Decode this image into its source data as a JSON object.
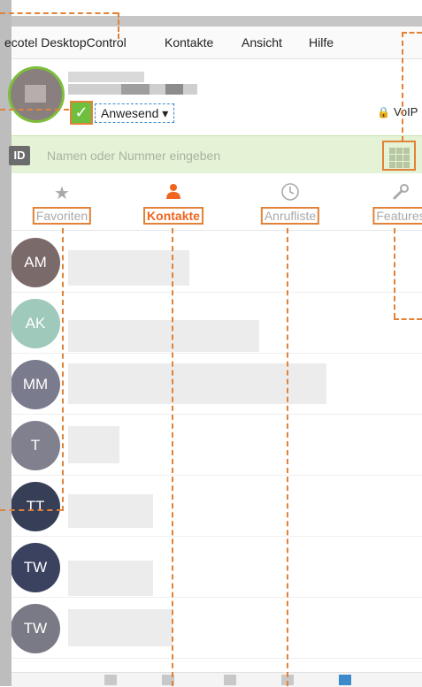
{
  "menu": {
    "app_title": "ecotel DesktopControl",
    "items": [
      "Kontakte",
      "Ansicht",
      "Hilfe"
    ]
  },
  "profile": {
    "status_label": "Anwesend",
    "status_caret": "▾",
    "voip_label": "VoIP",
    "status_color": "#6fbf3f"
  },
  "search": {
    "id_label": "ID",
    "placeholder": "Namen oder Nummer eingeben"
  },
  "tabs": [
    {
      "label": "Favoriten",
      "icon": "star-icon",
      "active": false
    },
    {
      "label": "Kontakte",
      "icon": "person-icon",
      "active": true
    },
    {
      "label": "Anrufliste",
      "icon": "clock-icon",
      "active": false
    },
    {
      "label": "Features",
      "icon": "wrench-icon",
      "active": false
    }
  ],
  "contacts": [
    {
      "initials": "AM",
      "color": "#7b6a6a"
    },
    {
      "initials": "AK",
      "color": "#9fc9bb"
    },
    {
      "initials": "MM",
      "color": "#7b7b8e"
    },
    {
      "initials": "T",
      "color": "#80808e"
    },
    {
      "initials": "TT",
      "color": "#373f57"
    },
    {
      "initials": "TW",
      "color": "#3a4260"
    },
    {
      "initials": "TW",
      "color": "#7a7a86"
    }
  ],
  "colors": {
    "accent": "#f0641e",
    "annotation": "#e08237",
    "search_bg": "#e4f2d6"
  }
}
